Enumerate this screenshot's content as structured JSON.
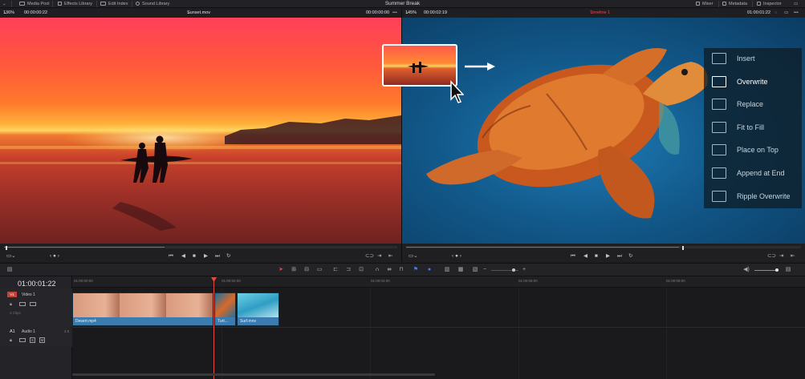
{
  "topbar": {
    "title": "Summer Break",
    "left_items": [
      {
        "label": "Media Pool",
        "icon": "media-pool-icon"
      },
      {
        "label": "Effects Library",
        "icon": "effects-library-icon"
      },
      {
        "label": "Edit Index",
        "icon": "edit-index-icon"
      },
      {
        "label": "Sound Library",
        "icon": "sound-library-icon"
      }
    ],
    "right_items": [
      {
        "label": "Mixer",
        "icon": "mixer-icon"
      },
      {
        "label": "Metadata",
        "icon": "metadata-icon"
      },
      {
        "label": "Inspector",
        "icon": "inspector-icon"
      }
    ]
  },
  "source_viewer": {
    "zoom": "136%",
    "timecode_left": "00:00:00:22",
    "clip_name": "Sunset.mov",
    "timecode_right": "00:00:00:00"
  },
  "timeline_viewer": {
    "zoom": "145%",
    "timecode_left": "00:00:02:19",
    "timeline_name": "Timeline 1",
    "timecode_right": "01:00:01:22"
  },
  "overlay_menu": {
    "items": [
      {
        "label": "Insert",
        "icon": "insert-icon",
        "active": false
      },
      {
        "label": "Overwrite",
        "icon": "overwrite-icon",
        "active": true
      },
      {
        "label": "Replace",
        "icon": "replace-icon",
        "active": false
      },
      {
        "label": "Fit to Fill",
        "icon": "fit-to-fill-icon",
        "active": false
      },
      {
        "label": "Place on Top",
        "icon": "place-on-top-icon",
        "active": false
      },
      {
        "label": "Append at End",
        "icon": "append-at-end-icon",
        "active": false
      },
      {
        "label": "Ripple Overwrite",
        "icon": "ripple-overwrite-icon",
        "active": false
      }
    ]
  },
  "timeline": {
    "current_timecode": "01:00:01:22",
    "ruler_ticks": [
      "01:00:00:00",
      "01:00:02:00",
      "01:00:04:00",
      "01:00:06:00",
      "01:00:08:00"
    ],
    "tracks": [
      {
        "id": "V1",
        "name": "Video 1",
        "info": "3 Clips"
      },
      {
        "id": "A1",
        "name": "Audio 1",
        "info": "2.0"
      }
    ],
    "clips": [
      {
        "name": "Desert.mp4"
      },
      {
        "name": "Turt..."
      },
      {
        "name": "Surf.mov"
      }
    ]
  },
  "colors": {
    "accent_red": "#e5484d",
    "playhead": "#e24a3e",
    "clip_blue": "#3a7bb0",
    "toolbar_blue": "#3b82f6"
  }
}
